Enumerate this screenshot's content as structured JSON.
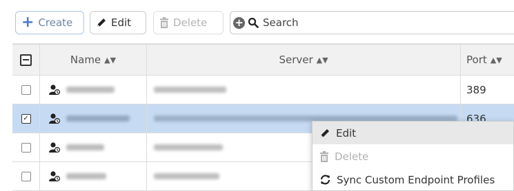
{
  "toolbar": {
    "create_label": "Create",
    "edit_label": "Edit",
    "delete_label": "Delete"
  },
  "search": {
    "placeholder": "Search",
    "value": ""
  },
  "table": {
    "columns": [
      "Name",
      "Server",
      "Port"
    ],
    "rows": [
      {
        "name": "",
        "server": "",
        "port": "389",
        "checked": false,
        "selected": false
      },
      {
        "name": "",
        "server": "",
        "port": "636",
        "checked": true,
        "selected": true
      },
      {
        "name": "",
        "server": "",
        "port": "",
        "checked": false,
        "selected": false
      },
      {
        "name": "",
        "server": "",
        "port": "",
        "checked": false,
        "selected": false
      }
    ]
  },
  "context_menu": {
    "items": [
      {
        "label": "Edit",
        "icon": "pencil-icon",
        "enabled": true
      },
      {
        "label": "Delete",
        "icon": "trash-icon",
        "enabled": false
      },
      {
        "label": "Sync Custom Endpoint Profiles",
        "icon": "sync-icon",
        "enabled": true
      }
    ]
  },
  "colors": {
    "accent": "#4c7bd4",
    "selected_row": "#c6dbf3",
    "header_bg": "#f1f1f1",
    "menu_hover": "#e8e8e8"
  }
}
